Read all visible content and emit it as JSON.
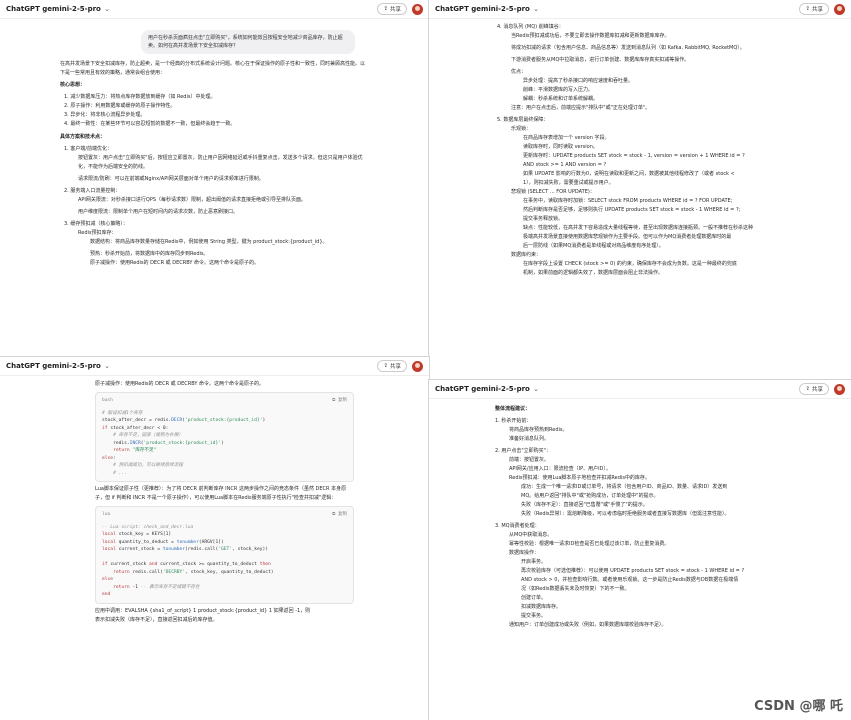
{
  "title": "ChatGPT gemini-2-5-pro",
  "share_label": "共享",
  "watermark": "CSDN @哪 吒",
  "w1": {
    "user_msg": "用户在秒杀页面疯狂点击\"立即购买\"，系统如何能效且按程安全地减少商品库存，防止超卖。如何在高并发场景下安全扣减库存？",
    "intro": "在高并发场景下安全扣减库存，防止超卖，是一个经典的分布式系统设计问题。核心在于保证操作的原子性和一致性，同时兼顾高性能。以下是一些常用且有效的策略，通常会组合使用：",
    "h1": "核心思想：",
    "core": [
      "1. 减少数据库压力：将热点库存数据放到缓存（如 Redis）中处理。",
      "2. 原子操作：利用数据库或缓存的原子操作特性。",
      "3. 异步化：将非核心流程异步处理。",
      "4. 最终一致性：在某些环节可以容忍短暂的数据不一致，但最终会趋于一致。"
    ],
    "h2": "具体方案和技术点：",
    "l1": "1. 客户端/前端优化：",
    "l1a": "按钮置灰：用户点击\"立即购买\"后，按钮应立即置灰，防止用户因网络延迟或手抖重复点击，发送多个请求。但这只是用户体验优化，不能作为后端安全的防线。",
    "l1b": "请求限流/防刷：可以在前端或Nginx/API网关层面对单个用户的请求频率进行限制。",
    "l2": "2. 服务端入口流量控制：",
    "l2a": "API网关限流：对秒杀接口进行QPS（每秒请求数）限制，超出阈值的请求直接拒绝或引导至排队页面。",
    "l2b": "用户维度限流：限制单个用户在短时间内的请求次数，防止恶意刷接口。",
    "l3": "3. 缓存预扣减（核心策略）：",
    "l3a": "Redis预扣库存：",
    "l3b": "数据结构：将商品库存数量存储在Redis中，例如使用 String 类型，键为 product_stock:{product_id}。",
    "l3c": "预热：秒杀开始前，将数据库中的库存同步到Redis。",
    "l3d": "原子减操作：使用Redis的 DECR 或 DECRBY 命令。这两个命令是原子的。"
  },
  "w2": {
    "h4": "4. 消息队列 (MQ) 削峰填谷：",
    "a": "当Redis预扣减成功后，不要立即去操作数据库扣减和更新数据库库存。",
    "b": "将成功扣减的请求（包含用户信息、商品信息等）发送到消息队列（如 Kafka, RabbitMQ, RocketMQ）。",
    "c": "下游消费者服务从MQ中拉取消息，进行订单创建、数据库库存真实扣减等操作。",
    "d": "优点：",
    "d1": "异步处理：提高了秒杀接口的响应速度和吞吐量。",
    "d2": "削峰：平滑数据库的写入压力。",
    "d3": "解耦：秒杀系统和订单系统解耦。",
    "e": "注意：用户在点击后，前端应提示\"排队中\"或\"正在处理订单\"。",
    "h5": "5. 数据库层最终保障：",
    "f": "乐观锁：",
    "f1": "在商品库存表增加一个 version 字段。",
    "f2": "读取库存时，同时读取 version。",
    "f3a": "更新库存时：UPDATE products SET stock = stock - 1, version = version + 1 WHERE id = ?",
    "f3b": "AND stock >= 1 AND version = ?",
    "f4a": "如果 UPDATE 影响的行数为0，说明在读取和更新之间，数据被其他线程修改了（或者 stock <",
    "f4b": "1），则扣减失败，需要重试或提示用户。",
    "g": "悲观锁 (SELECT ... FOR UPDATE)：",
    "g1": "在事务中，读取库存时加锁：SELECT stock FROM products WHERE id = ? FOR UPDATE;",
    "g2": "然后判断库存是否足够，足够则执行 UPDATE products SET stock = stock - 1 WHERE id = ?;",
    "g3": "提交事务释放锁。",
    "g4a": "缺点：性能较低，在高并发下容易造成大量线程等待，甚至出现数据库连接瓶颈。一般不推荐在秒杀这种",
    "g4b": "极端高并发场景直接使用数据库悲观锁作为主要手段。但可以作为MQ消费者处理数据库时的最",
    "g4c": "后一层防线（如果MQ消费者是单线程或对商品维度有序处理）。",
    "h": "数据库约束：",
    "h1": "在库存字段上设置 CHECK (stock >= 0) 的约束，确保库存不会成为负数。这是一种最终的兜底",
    "h2": "机制，如果前面的逻辑都失效了，数据库层面会阻止非法操作。"
  },
  "w3": {
    "top": "原子减操作：使用Redis的 DECR 或 DECRBY 命令。这两个命令是原子的。",
    "code1_lang": "bash",
    "copy": "复制",
    "lua_label": "Lua脚本保证原子性（更推荐）：为了将 DECR 前判断库存 INCR 这两步操作之间的竞态条件（虽然 DECR 本身原子，但 if 判断和 INCR 不是一个原子操作），可以使用Lua脚本在Redis服务端原子性执行\"检查并扣减\"逻辑：",
    "code2_lang": "lua",
    "foot1": "应用中调用：EVALSHA {sha1_of_script} 1 product_stock:{product_id} 1 如果返回 -1，则",
    "foot2": "表示扣减失败（库存不足），直接返回扣减后的库存值。"
  },
  "w4": {
    "head": "整体流程建议：",
    "s1": "1. 秒杀开始前：",
    "s1a": "将商品库存预热到Redis。",
    "s1b": "准备好消息队列。",
    "s2": "2. 用户点击\"立即购买\"：",
    "s2a": "前端：按钮置灰。",
    "s2b": "API网关/应用入口：限流检查（IP、用户ID）。",
    "s2c": "Redis预扣减：使用Lua脚本原子地检查并扣减Redis中的库存。",
    "s2c1": "成功：生成一个唯一请求ID或订单号，将请求（包含用户ID、商品ID、数量、请求ID）发送到",
    "s2c1b": "MQ。给用户返回\"排队中\"或\"抢购成功，订单处理中\"的提示。",
    "s2c2": "失败（库存不足）：直接返回\"已售罄\"或\"手慢了\"的提示。",
    "s2c3": "失败（Redis异常）：需熔断降级，可以考虑临时拒绝服务或者直接写数据库（但需注意性能）。",
    "s3": "3. MQ消费者处理：",
    "s3a": "从MQ中获取消息。",
    "s3b": "幂等性校验：根据唯一请求ID检查是否已处理过该订单，防止重复消费。",
    "s3c": "数据库操作：",
    "s3c1": "开启事务。",
    "s3c2a": "再次校验库存（可选但推荐）：可以使用 UPDATE products SET stock = stock - 1 WHERE id = ?",
    "s3c2b": "AND stock > 0，并检查影响行数。或者使用乐观锁。这一步是防止Redis数据与DB数据在极端情",
    "s3c2c": "况（如Redis数据丢失未及时恢复）下的不一致。",
    "s3c3": "创建订单。",
    "s3c4": "扣减数据库库存。",
    "s3c5": "提交事务。",
    "s3d": "通知用户：订单创建成功或失败（例如，如果数据库端校验库存不足）。"
  }
}
